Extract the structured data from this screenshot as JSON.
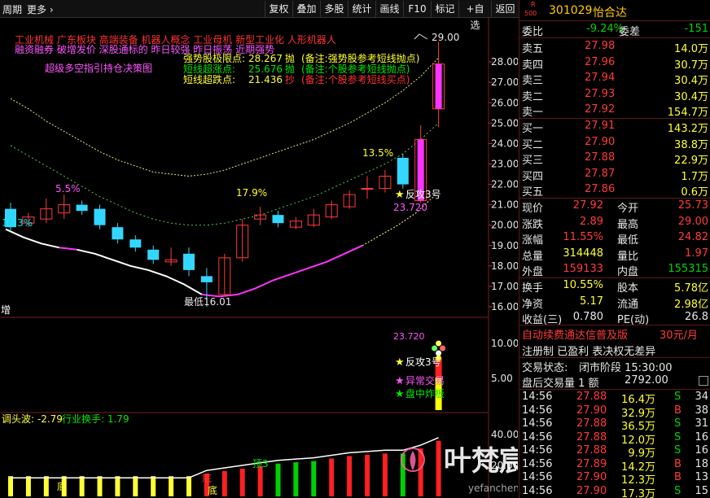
{
  "toolbar": {
    "period": "周期",
    "more": "更多",
    "buttons": [
      "复权",
      "叠加",
      "多股",
      "统计",
      "画线",
      "F10",
      "标记",
      "+自选",
      "返回"
    ]
  },
  "stock": {
    "badge_top": "R",
    "badge_bottom": "500",
    "code": "301029",
    "name": "怡合达"
  },
  "summary": {
    "webi_label": "委比",
    "webi_value": "-9.24%",
    "weicha_label": "委差",
    "weicha_value": "-151"
  },
  "asks": [
    {
      "label": "卖五",
      "price": "27.98",
      "vol": "14.0万"
    },
    {
      "label": "卖四",
      "price": "27.96",
      "vol": "30.7万"
    },
    {
      "label": "卖三",
      "price": "27.94",
      "vol": "30.4万"
    },
    {
      "label": "卖二",
      "price": "27.93",
      "vol": "30.4万"
    },
    {
      "label": "卖一",
      "price": "27.92",
      "vol": "154.7万"
    }
  ],
  "bids": [
    {
      "label": "买一",
      "price": "27.91",
      "vol": "143.2万"
    },
    {
      "label": "买二",
      "price": "27.90",
      "vol": "38.8万"
    },
    {
      "label": "买三",
      "price": "27.88",
      "vol": "22.9万"
    },
    {
      "label": "买四",
      "price": "27.87",
      "vol": "1.7万"
    },
    {
      "label": "买五",
      "price": "27.86",
      "vol": "0.6万"
    }
  ],
  "stats": [
    {
      "l1": "现价",
      "v1": "27.92",
      "l2": "今开",
      "v2": "25.73"
    },
    {
      "l1": "涨跌",
      "v1": "2.89",
      "l2": "最高",
      "v2": "29.00"
    },
    {
      "l1": "涨幅",
      "v1": "11.55%",
      "l2": "最低",
      "v2": "24.82"
    },
    {
      "l1": "总量",
      "v1": "314448",
      "l2": "量比",
      "v2": "1.97"
    },
    {
      "l1": "外盘",
      "v1": "159133",
      "l2": "内盘",
      "v2": "155315"
    }
  ],
  "stats2": [
    {
      "l1": "换手",
      "v1": "10.55%",
      "l2": "股本",
      "v2": "5.78亿"
    },
    {
      "l1": "净资",
      "v1": "5.17",
      "l2": "流通",
      "v2": "2.98亿"
    },
    {
      "l1": "收益(三)",
      "v1": "0.780",
      "l2": "PE(动)",
      "v2": "26.8"
    }
  ],
  "promo": {
    "line1": "自动续费通达信普及版",
    "price": "30元/月",
    "line2": "注册制 已盈利 表决权无差异"
  },
  "trade_status": {
    "label": "交易状态:",
    "value": "闭市阶段 15:30:00"
  },
  "after_hours": {
    "label": "盘后交易量 1 额",
    "value": "2792.00"
  },
  "ticks": [
    {
      "time": "14:56",
      "price": "27.88",
      "vol": "16.4万",
      "side": "S",
      "n": "34"
    },
    {
      "time": "14:56",
      "price": "27.90",
      "vol": "32.9万",
      "side": "B",
      "n": "38"
    },
    {
      "time": "14:56",
      "price": "27.88",
      "vol": "36.5万",
      "side": "S",
      "n": "31"
    },
    {
      "time": "14:56",
      "price": "27.88",
      "vol": "12.0万",
      "side": "S",
      "n": "16"
    },
    {
      "time": "14:56",
      "price": "27.88",
      "vol": "9.9万",
      "side": "S",
      "n": "16"
    },
    {
      "time": "14:56",
      "price": "27.89",
      "vol": "14.2万",
      "side": "B",
      "n": "18"
    },
    {
      "time": "14:56",
      "price": "27.90",
      "vol": "12.3万",
      "side": "B",
      "n": "13"
    },
    {
      "time": "14:56",
      "price": "27.90",
      "vol": "17.3万",
      "side": "S",
      "n": "15"
    }
  ],
  "chart_text": {
    "concepts": "工业机械 广东板块 高端装备 机器人概念 工业母机 新型工业化 人形机器人",
    "line2": "融资融券 破增发价 深股通标的 昨日较强 昨日振荡 近期强势",
    "line3": "超级多空指引持仓决策图",
    "legend": [
      {
        "name": "强势股极限点:",
        "value": "28.267",
        "tag": "抛",
        "note": "(备注:强势股参考短线抛点)",
        "color": "#ffff33"
      },
      {
        "name": "短线超涨点:",
        "value": "25.676",
        "tag": "抛",
        "note": "(备注:个股参考短线抛点)",
        "color": "#00e600"
      },
      {
        "name": "短线超跌点:",
        "value": "21.436",
        "tag": "抄",
        "note": "(备注:个股参考短线买点)",
        "color": "#ffff33"
      }
    ],
    "high_label": "29.00",
    "low_label": "最低16.01",
    "pct_labels": [
      "16.3%",
      "5.5%",
      "17.9%",
      "13.5%"
    ],
    "signal1": "反攻3号",
    "signal1_price": "23.720",
    "side_label": "增",
    "sub_signals": [
      "23.720",
      "反攻3号",
      "异常交易",
      "盘中炸板"
    ],
    "sub3_title": "调头波: -2.79",
    "sub3_value": "行业换手: 1.79",
    "sub3_labels": [
      "底",
      "顶3",
      "底",
      "底"
    ],
    "watermark_main": "叶梵宸指标公式网",
    "watermark_url": "yefanchen.com"
  },
  "chart_data": {
    "type": "candlestick",
    "y_ticks": [
      28.0,
      27.0,
      26.0,
      25.0,
      24.0,
      23.0,
      22.0,
      21.0,
      20.0,
      19.0,
      18.0,
      17.0,
      16.0
    ],
    "ylim": [
      15.8,
      29.6
    ],
    "sub_y_ticks": [
      10.0,
      5.0
    ],
    "sub3_y_ticks": [
      40.0,
      20.0
    ],
    "candles": [
      {
        "o": 20.8,
        "c": 19.9,
        "h": 21.1,
        "l": 19.7
      },
      {
        "o": 20.1,
        "c": 20.4,
        "h": 20.6,
        "l": 19.9
      },
      {
        "o": 20.3,
        "c": 20.8,
        "h": 21.3,
        "l": 20.1
      },
      {
        "o": 20.6,
        "c": 21.0,
        "h": 21.5,
        "l": 20.3
      },
      {
        "o": 21.0,
        "c": 20.7,
        "h": 21.2,
        "l": 20.5
      },
      {
        "o": 20.8,
        "c": 20.0,
        "h": 21.0,
        "l": 19.8
      },
      {
        "o": 19.9,
        "c": 19.3,
        "h": 20.1,
        "l": 19.1
      },
      {
        "o": 19.3,
        "c": 18.9,
        "h": 19.5,
        "l": 18.7
      },
      {
        "o": 18.8,
        "c": 18.3,
        "h": 19.0,
        "l": 18.1
      },
      {
        "o": 18.2,
        "c": 18.3,
        "h": 18.9,
        "l": 18.0
      },
      {
        "o": 18.6,
        "c": 17.8,
        "h": 18.9,
        "l": 17.5
      },
      {
        "o": 17.5,
        "c": 17.2,
        "h": 17.9,
        "l": 16.0
      },
      {
        "o": 16.6,
        "c": 18.4,
        "h": 18.6,
        "l": 16.5
      },
      {
        "o": 18.4,
        "c": 20.0,
        "h": 20.3,
        "l": 18.2
      },
      {
        "o": 20.3,
        "c": 20.5,
        "h": 20.9,
        "l": 20.0
      },
      {
        "o": 20.5,
        "c": 20.1,
        "h": 20.7,
        "l": 19.9
      },
      {
        "o": 19.9,
        "c": 20.2,
        "h": 20.4,
        "l": 19.8
      },
      {
        "o": 20.0,
        "c": 20.5,
        "h": 20.8,
        "l": 19.9
      },
      {
        "o": 20.4,
        "c": 21.0,
        "h": 21.2,
        "l": 20.3
      },
      {
        "o": 20.9,
        "c": 21.5,
        "h": 21.7,
        "l": 20.8
      },
      {
        "o": 21.8,
        "c": 21.8,
        "h": 22.4,
        "l": 21.3
      },
      {
        "o": 21.8,
        "c": 22.4,
        "h": 22.7,
        "l": 21.6
      },
      {
        "o": 23.3,
        "c": 22.0,
        "h": 23.5,
        "l": 21.8
      },
      {
        "o": 21.2,
        "c": 24.2,
        "h": 24.9,
        "l": 21.1
      },
      {
        "o": 25.7,
        "c": 27.9,
        "h": 29.0,
        "l": 24.8
      }
    ],
    "sub3_bars": [
      {
        "v": 16,
        "c": "#ffff33"
      },
      {
        "v": 16,
        "c": "#ffff33"
      },
      {
        "v": 16,
        "c": "#ffff33"
      },
      {
        "v": 16,
        "c": "#ffff33"
      },
      {
        "v": 16,
        "c": "#ffff33"
      },
      {
        "v": 16,
        "c": "#ffff33"
      },
      {
        "v": 16,
        "c": "#ffff33"
      },
      {
        "v": 16,
        "c": "#ffff33"
      },
      {
        "v": 16,
        "c": "#ffff33"
      },
      {
        "v": 16,
        "c": "#ffff33"
      },
      {
        "v": 16,
        "c": "#ffff33"
      },
      {
        "v": 18,
        "c": "#ff2020"
      },
      {
        "v": 20,
        "c": "#ff2020"
      },
      {
        "v": 22,
        "c": "#ff2020"
      },
      {
        "v": 24,
        "c": "#ff2020"
      },
      {
        "v": 26,
        "c": "#00d000"
      },
      {
        "v": 27,
        "c": "#00d000"
      },
      {
        "v": 28,
        "c": "#00d000"
      },
      {
        "v": 30,
        "c": "#ff2020"
      },
      {
        "v": 32,
        "c": "#ff2020"
      },
      {
        "v": 33,
        "c": "#ff2020"
      },
      {
        "v": 34,
        "c": "#ff2020"
      },
      {
        "v": 34,
        "c": "#00d000"
      },
      {
        "v": 38,
        "c": "#ff2020"
      },
      {
        "v": 44,
        "c": "#ff2020"
      }
    ]
  }
}
